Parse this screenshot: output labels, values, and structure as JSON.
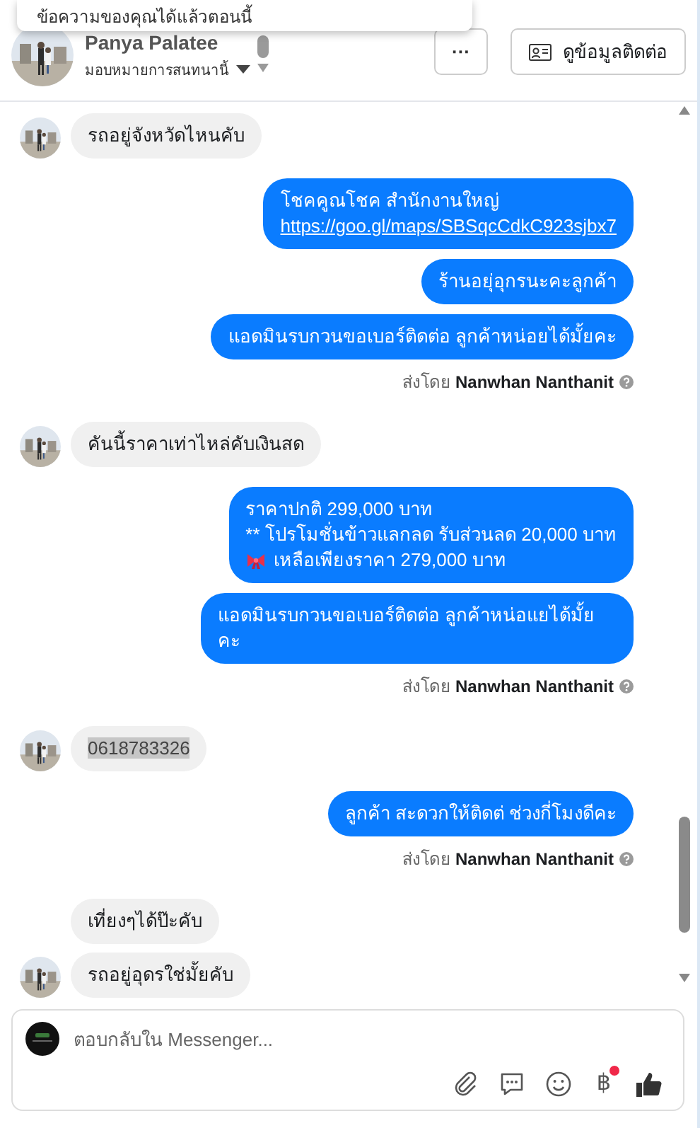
{
  "popup": {
    "text": "ข้อความของคุณได้แล้วตอนนี้"
  },
  "header": {
    "contact_name": "Panya Palatee",
    "assign_label": "มอบหมายการสนทนานี้",
    "more_button": "···",
    "contact_button": "ดูข้อมูลติดต่อ"
  },
  "messages": [
    {
      "kind": "incoming",
      "text": "รถอยู่จังหวัดไหนคับ"
    },
    {
      "kind": "outgoing",
      "text": "โชคคูณโชค สำนักงานใหญ่",
      "link": "https://goo.gl/maps/SBSqcCdkC923sjbx7"
    },
    {
      "kind": "outgoing",
      "text": "ร้านอยุ่อุกรนะคะลูกค้า"
    },
    {
      "kind": "outgoing",
      "text": "แอดมินรบกวนขอเบอร์ติดต่อ ลูกค้าหน่อยได้มั้ยคะ"
    },
    {
      "kind": "sent_by",
      "label": "ส่งโดย",
      "sender": "Nanwhan Nanthanit"
    },
    {
      "kind": "incoming",
      "text": "คันนี้ราคาเท่าไหล่คับเงินสด"
    },
    {
      "kind": "outgoing",
      "lines": [
        {
          "text": "ราคาปกติ 299,000 บาท",
          "ribbon": false
        },
        {
          "text": "** โปรโมชั่นข้าวแลกลด รับส่วนลด 20,000 บาท",
          "ribbon": false
        },
        {
          "text": "เหลือเพียงราคา 279,000 บาท",
          "ribbon": true
        }
      ]
    },
    {
      "kind": "outgoing",
      "text": "แอดมินรบกวนขอเบอร์ติดต่อ ลูกค้าหน่อแยได้มั้ยคะ"
    },
    {
      "kind": "sent_by",
      "label": "ส่งโดย",
      "sender": "Nanwhan Nanthanit"
    },
    {
      "kind": "incoming",
      "text": "0618783326",
      "highlighted": true
    },
    {
      "kind": "outgoing",
      "text": "ลูกค้า สะดวกให้ติดต่ ช่วงกี่โมงดีคะ"
    },
    {
      "kind": "sent_by",
      "label": "ส่งโดย",
      "sender": "Nanwhan Nanthanit"
    },
    {
      "kind": "incoming",
      "text": "เที่ยงๆได้ป๊ะคับ"
    },
    {
      "kind": "incoming",
      "text": "รถอยู่อุดรใช่มั้ยคับ"
    }
  ],
  "composer": {
    "placeholder": "ตอบกลับใน Messenger...",
    "currency_symbol": "฿",
    "currency_badge": true
  }
}
